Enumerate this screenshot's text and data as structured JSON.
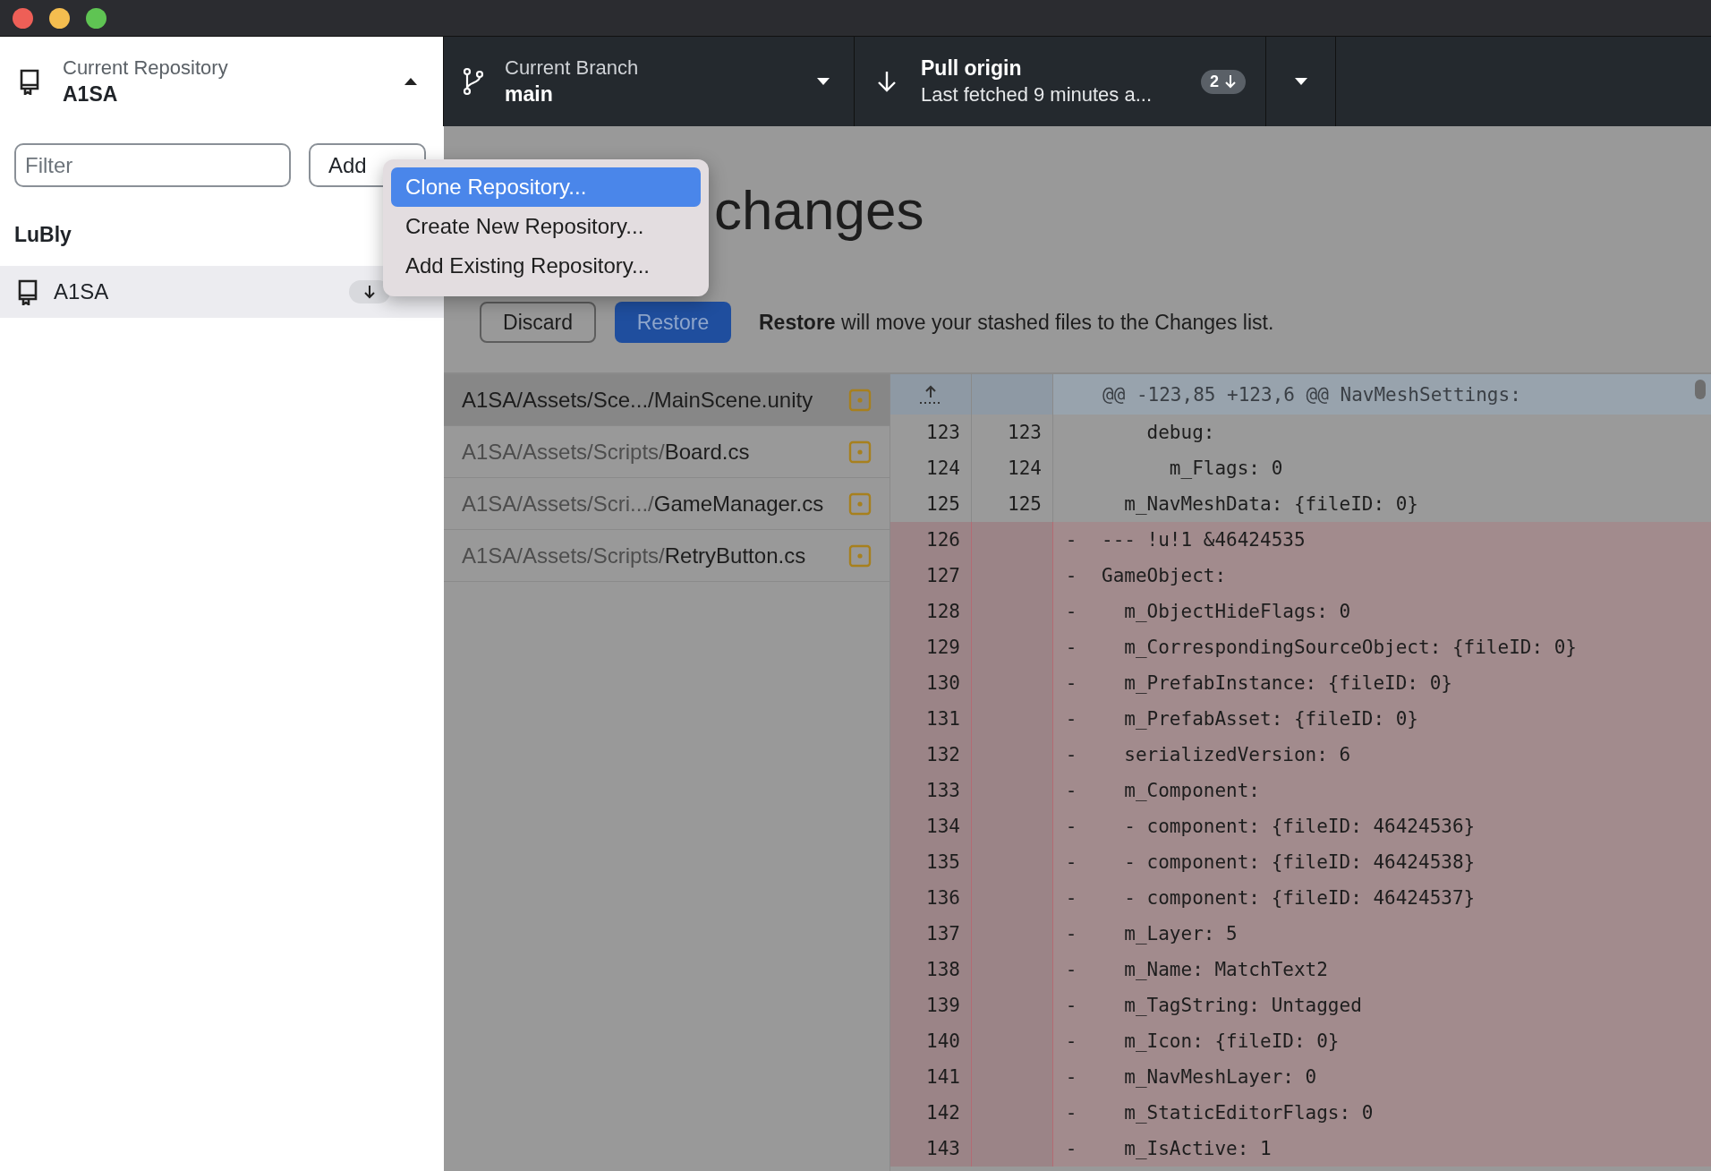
{
  "toolbar": {
    "repository": {
      "label": "Current Repository",
      "value": "A1SA"
    },
    "branch": {
      "label": "Current Branch",
      "value": "main"
    },
    "pull": {
      "title": "Pull origin",
      "subtitle": "Last fetched 9 minutes a...",
      "count": "2"
    }
  },
  "sidebar": {
    "filter": {
      "placeholder": "Filter"
    },
    "add_button": "Add",
    "groups": [
      {
        "name": "LuBly",
        "repositories": [
          {
            "name": "A1SA",
            "selected": true
          }
        ]
      }
    ]
  },
  "add_menu": [
    {
      "label": "Clone Repository...",
      "selected": true
    },
    {
      "label": "Create New Repository...",
      "selected": false
    },
    {
      "label": "Add Existing Repository...",
      "selected": false
    }
  ],
  "stash": {
    "title": "changes",
    "discard": "Discard",
    "restore": "Restore",
    "note": "**Restore** will move your stashed files to the Changes list."
  },
  "files": [
    {
      "dir": "A1SA/Assets/Sce.../",
      "name": "MainScene.unity",
      "selected": true
    },
    {
      "dir": "A1SA/Assets/Scripts/",
      "name": "Board.cs",
      "selected": false
    },
    {
      "dir": "A1SA/Assets/Scri.../",
      "name": "GameManager.cs",
      "selected": false
    },
    {
      "dir": "A1SA/Assets/Scripts/",
      "name": "RetryButton.cs",
      "selected": false
    }
  ],
  "diff": {
    "hunk": "@@ -123,85 +123,6 @@ NavMeshSettings:",
    "lines": [
      {
        "kind": "context",
        "old": "123",
        "new": "123",
        "text": "    debug:"
      },
      {
        "kind": "context",
        "old": "124",
        "new": "124",
        "text": "      m_Flags: 0"
      },
      {
        "kind": "context",
        "old": "125",
        "new": "125",
        "text": "  m_NavMeshData: {fileID: 0}"
      },
      {
        "kind": "deleted",
        "old": "126",
        "sign": "-",
        "text": "--- !u!1 &46424535"
      },
      {
        "kind": "deleted",
        "old": "127",
        "sign": "-",
        "text": "GameObject:"
      },
      {
        "kind": "deleted",
        "old": "128",
        "sign": "-",
        "text": "  m_ObjectHideFlags: 0"
      },
      {
        "kind": "deleted",
        "old": "129",
        "sign": "-",
        "text": "  m_CorrespondingSourceObject: {fileID: 0}"
      },
      {
        "kind": "deleted",
        "old": "130",
        "sign": "-",
        "text": "  m_PrefabInstance: {fileID: 0}"
      },
      {
        "kind": "deleted",
        "old": "131",
        "sign": "-",
        "text": "  m_PrefabAsset: {fileID: 0}"
      },
      {
        "kind": "deleted",
        "old": "132",
        "sign": "-",
        "text": "  serializedVersion: 6"
      },
      {
        "kind": "deleted",
        "old": "133",
        "sign": "-",
        "text": "  m_Component:"
      },
      {
        "kind": "deleted",
        "old": "134",
        "sign": "-",
        "text": "  - component: {fileID: 46424536}"
      },
      {
        "kind": "deleted",
        "old": "135",
        "sign": "-",
        "text": "  - component: {fileID: 46424538}"
      },
      {
        "kind": "deleted",
        "old": "136",
        "sign": "-",
        "text": "  - component: {fileID: 46424537}"
      },
      {
        "kind": "deleted",
        "old": "137",
        "sign": "-",
        "text": "  m_Layer: 5"
      },
      {
        "kind": "deleted",
        "old": "138",
        "sign": "-",
        "text": "  m_Name: MatchText2"
      },
      {
        "kind": "deleted",
        "old": "139",
        "sign": "-",
        "text": "  m_TagString: Untagged"
      },
      {
        "kind": "deleted",
        "old": "140",
        "sign": "-",
        "text": "  m_Icon: {fileID: 0}"
      },
      {
        "kind": "deleted",
        "old": "141",
        "sign": "-",
        "text": "  m_NavMeshLayer: 0"
      },
      {
        "kind": "deleted",
        "old": "142",
        "sign": "-",
        "text": "  m_StaticEditorFlags: 0"
      },
      {
        "kind": "deleted",
        "old": "143",
        "sign": "-",
        "text": "  m_IsActive: 1"
      }
    ]
  }
}
